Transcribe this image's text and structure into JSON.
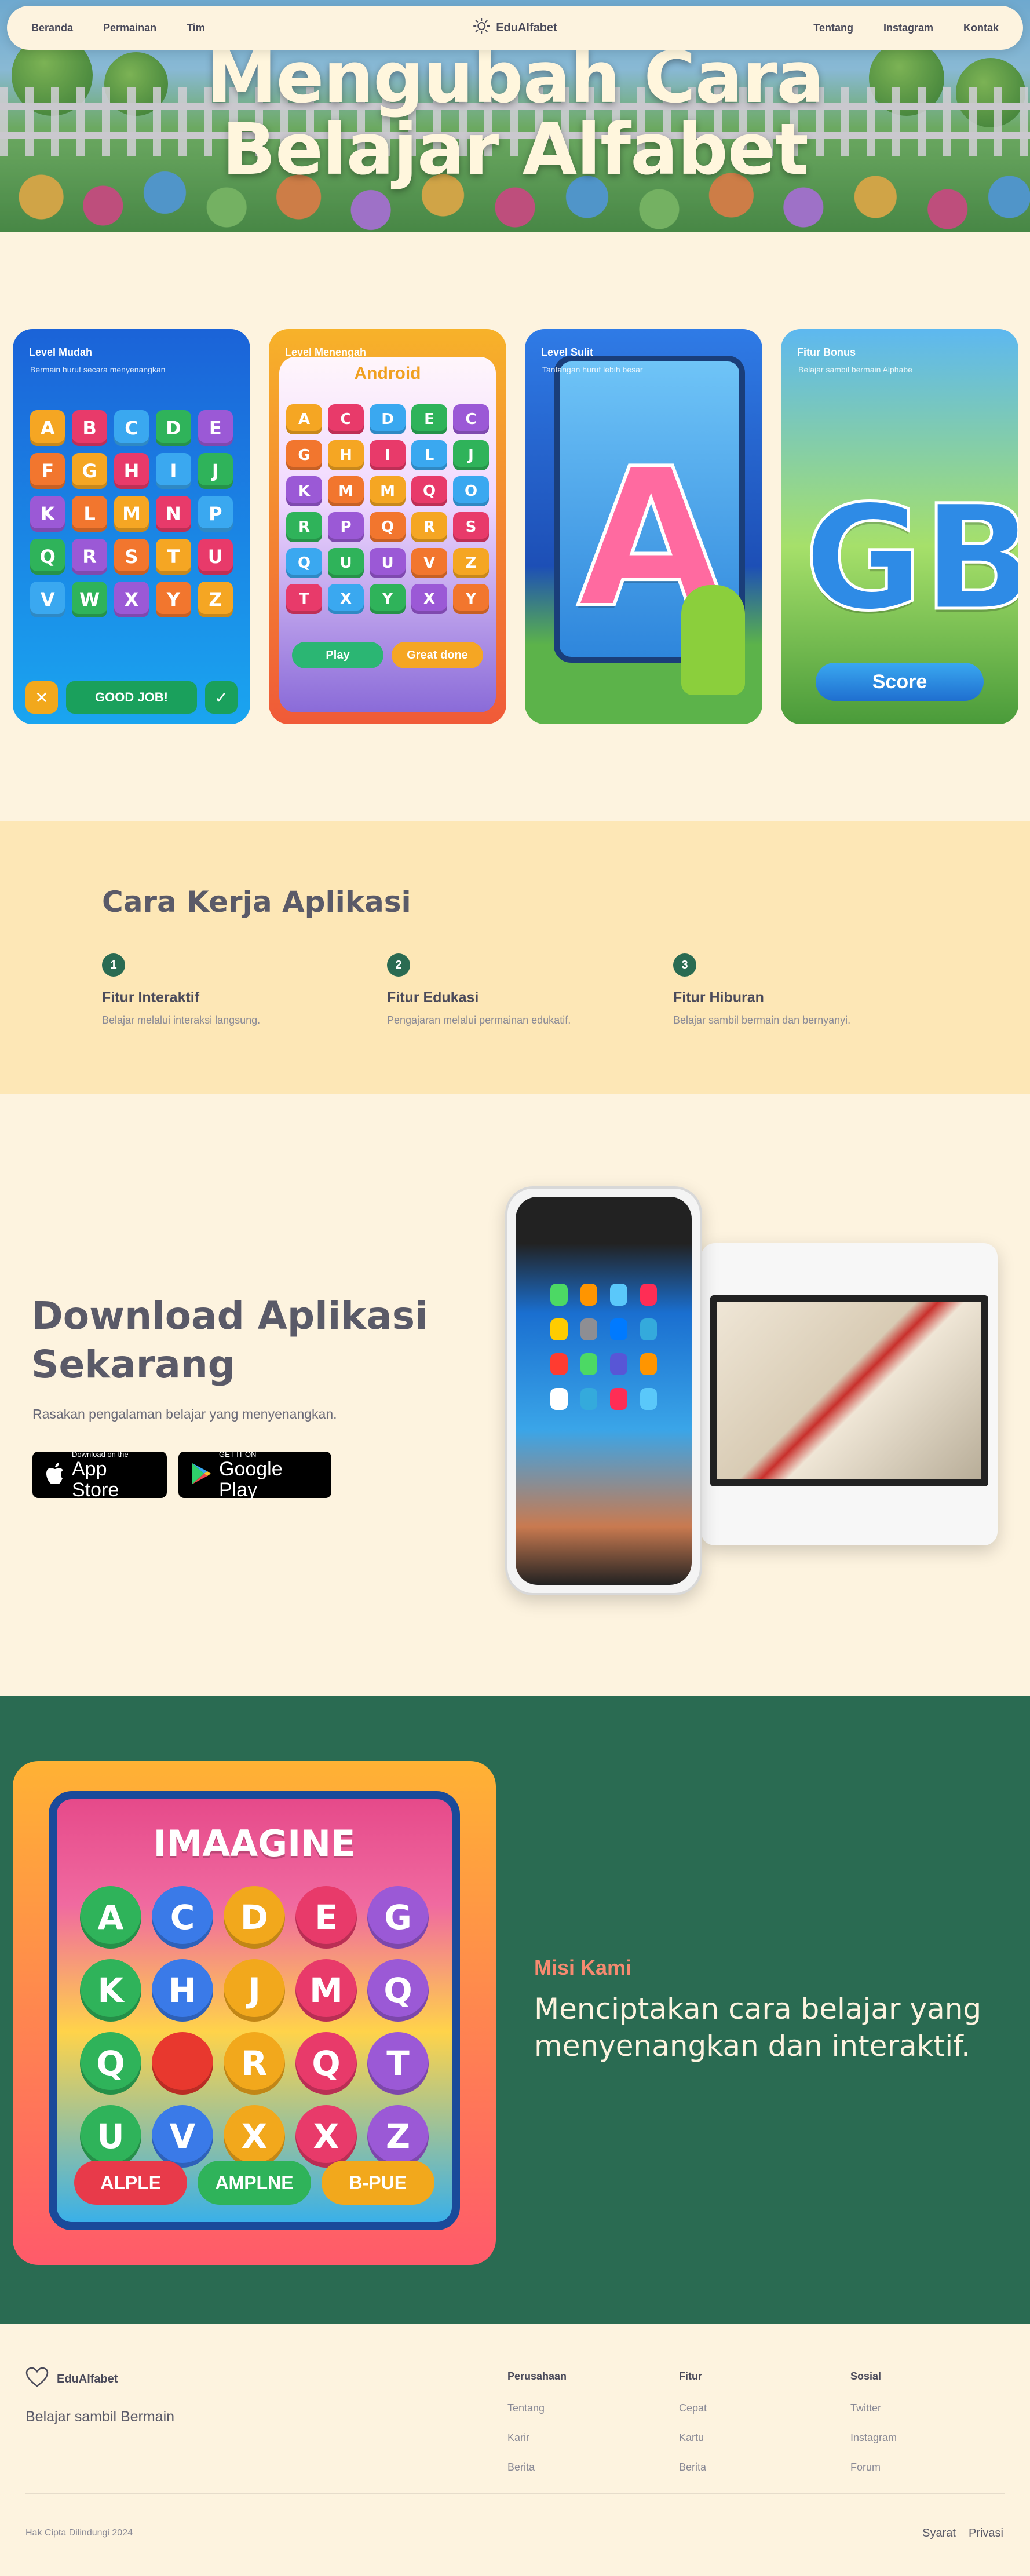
{
  "nav": {
    "left": [
      "Beranda",
      "Permainan",
      "Tim"
    ],
    "brand": "EduAlfabet",
    "right": [
      "Tentang",
      "Instagram",
      "Kontak"
    ]
  },
  "hero": {
    "title_line1": "Mengubah Cara",
    "title_line2": "Belajar Alfabet"
  },
  "cards": [
    {
      "label": "Level Mudah",
      "sub": "Bermain huruf secara menyenangkan",
      "tiles": [
        "A",
        "B",
        "C",
        "D",
        "E",
        "F",
        "G",
        "H",
        "I",
        "J",
        "K",
        "L",
        "M",
        "N",
        "P",
        "Q",
        "R",
        "S",
        "T",
        "U",
        "V",
        "W",
        "X",
        "Y",
        "Z"
      ],
      "footer": "GOOD JOB!"
    },
    {
      "label": "Level Menengah",
      "title": "Android",
      "tiles": [
        "A",
        "C",
        "D",
        "E",
        "C",
        "G",
        "H",
        "I",
        "L",
        "J",
        "K",
        "M",
        "M",
        "Q",
        "O",
        "R",
        "P",
        "Q",
        "R",
        "S",
        "Q",
        "U",
        "U",
        "V",
        "Z",
        "T",
        "X",
        "Y",
        "X",
        "Y"
      ],
      "btn1": "Play",
      "btn2": "Great done"
    },
    {
      "label": "Level Sulit",
      "sub": "Tantangan huruf lebih besar",
      "letter": "A"
    },
    {
      "label": "Fitur Bonus",
      "sub": "Belajar sambil bermain Alphabe",
      "letters": "GB",
      "score": "Score"
    }
  ],
  "how": {
    "title": "Cara Kerja Aplikasi",
    "features": [
      {
        "num": "1",
        "title": "Fitur Interaktif",
        "desc": "Belajar melalui interaksi langsung."
      },
      {
        "num": "2",
        "title": "Fitur Edukasi",
        "desc": "Pengajaran melalui permainan edukatif."
      },
      {
        "num": "3",
        "title": "Fitur Hiburan",
        "desc": "Belajar sambil bermain dan bernyanyi."
      }
    ]
  },
  "download": {
    "title_line1": "Download Aplikasi",
    "title_line2": "Sekarang",
    "subtitle": "Rasakan pengalaman belajar yang menyenangkan.",
    "appstore_small": "Download on the",
    "appstore_big": "App Store",
    "play_small": "GET IT ON",
    "play_big": "Google Play"
  },
  "mission": {
    "image_title": "IMAAGINE",
    "bubbles": [
      "A",
      "C",
      "D",
      "E",
      "G",
      "K",
      "H",
      "J",
      "M",
      "Q",
      "Q",
      "",
      "R",
      "Q",
      "T",
      "U",
      "V",
      "X",
      "X",
      "Z"
    ],
    "buttons": [
      "ALPLE",
      "AMPLNE",
      "B-PUE"
    ],
    "label": "Misi Kami",
    "text": "Menciptakan cara belajar yang menyenangkan dan interaktif."
  },
  "footer": {
    "brand": "EduAlfabet",
    "tagline": "Belajar sambil Bermain",
    "cols": [
      {
        "heading": "Perusahaan",
        "links": [
          "Tentang",
          "Karir",
          "Berita"
        ]
      },
      {
        "heading": "Fitur",
        "links": [
          "Cepat",
          "Kartu",
          "Berita"
        ]
      },
      {
        "heading": "Sosial",
        "links": [
          "Twitter",
          "Instagram",
          "Forum"
        ]
      }
    ],
    "copyright": "Hak Cipta Dilindungi 2024",
    "legal": [
      "Syarat",
      "Privasi"
    ]
  },
  "colors": {
    "cream": "#fdf3df",
    "sand": "#fde7b6",
    "green": "#2a6b52",
    "coral": "#f58a70"
  }
}
